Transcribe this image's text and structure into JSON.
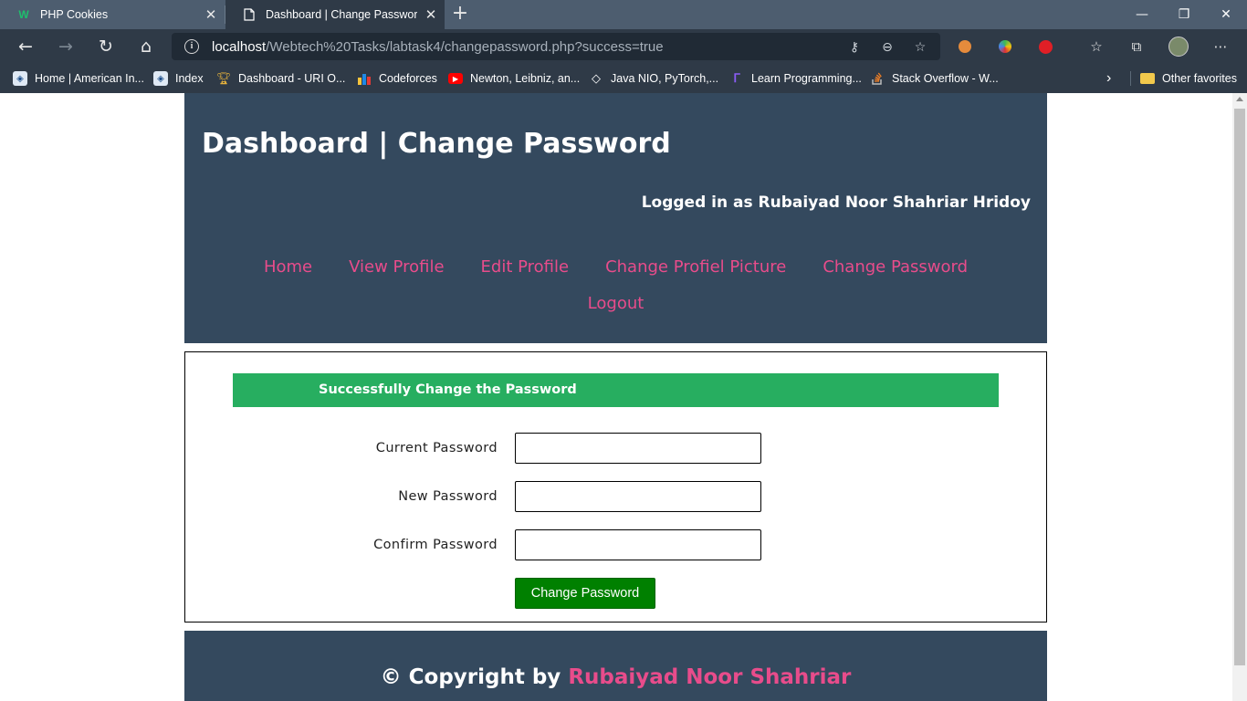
{
  "browser": {
    "tabs": [
      {
        "title": "PHP Cookies",
        "icon": "w-logo-icon",
        "active": false
      },
      {
        "title": "Dashboard | Change Password",
        "icon": "page-icon",
        "active": true
      }
    ],
    "address": {
      "host": "localhost",
      "path": "/Webtech%20Tasks/labtask4/changepassword.php?success=true"
    },
    "bookmarks": [
      {
        "label": "Home | American In...",
        "icon": "shield-icon"
      },
      {
        "label": "Index",
        "icon": "shield-icon"
      },
      {
        "label": "Dashboard - URI O...",
        "icon": "trophy-icon"
      },
      {
        "label": "Codeforces",
        "icon": "bar-chart-icon"
      },
      {
        "label": "Newton, Leibniz, an...",
        "icon": "youtube-icon"
      },
      {
        "label": "Java NIO, PyTorch,...",
        "icon": "diamond-icon"
      },
      {
        "label": "Learn Programming...",
        "icon": "play-logo-icon"
      },
      {
        "label": "Stack Overflow - W...",
        "icon": "stackoverflow-icon"
      }
    ],
    "other_favorites": "Other favorites"
  },
  "page": {
    "title": "Dashboard | Change Password",
    "logged_in": "Logged in as Rubaiyad Noor Shahriar Hridoy",
    "nav": [
      "Home",
      "View Profile",
      "Edit Profile",
      "Change Profiel Picture",
      "Change Password",
      "Logout"
    ],
    "success_message": "Successfully Change the Password",
    "form": {
      "current_label": "Current Password",
      "new_label": "New Password",
      "confirm_label": "Confirm Password",
      "current_value": "",
      "new_value": "",
      "confirm_value": "",
      "submit_label": "Change Password"
    },
    "footer": {
      "prefix": "© Copyright by",
      "name": "Rubaiyad Noor Shahriar"
    }
  },
  "colors": {
    "header_bg": "#34495e",
    "accent_pink": "#e84c8b",
    "success_green": "#27ae60",
    "button_green": "#008000"
  }
}
